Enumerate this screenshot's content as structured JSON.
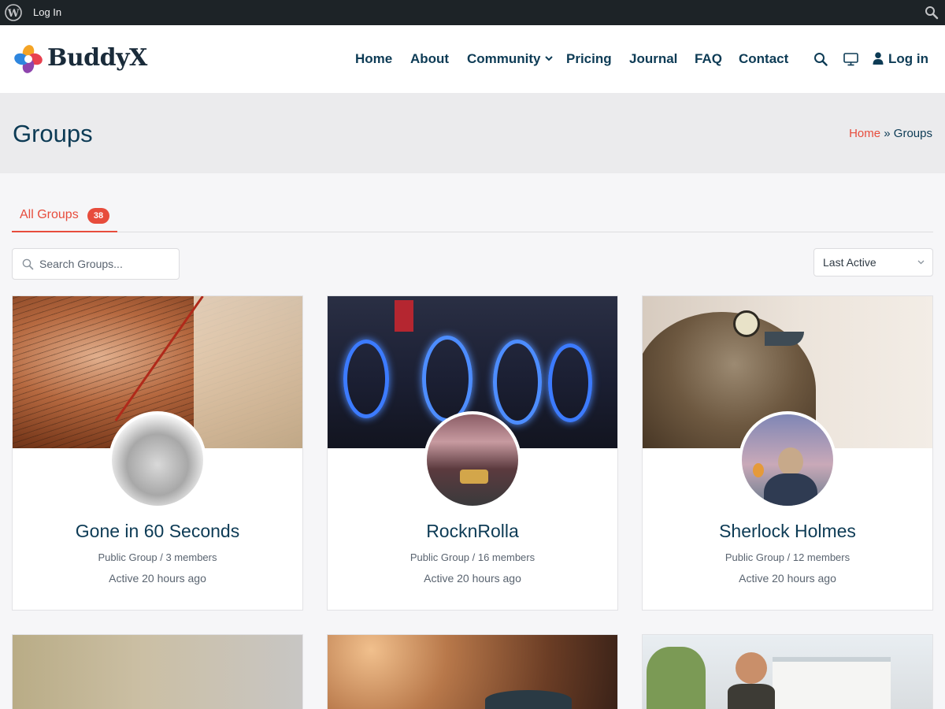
{
  "admin_bar": {
    "wp_icon": "wordpress-icon",
    "login_label": "Log In",
    "search_icon": "search-icon"
  },
  "header": {
    "logo_text": "BuddyX",
    "nav": [
      "Home",
      "About",
      "Community",
      "Pricing",
      "Journal",
      "FAQ",
      "Contact"
    ],
    "login_label": "Log in",
    "icons": [
      "search-icon",
      "monitor-icon",
      "user-icon",
      "chevron-down-icon"
    ]
  },
  "page": {
    "title": "Groups",
    "breadcrumb": {
      "home": "Home",
      "separator": "»",
      "current": "Groups"
    }
  },
  "tabs": {
    "all_label": "All Groups",
    "all_count": "38"
  },
  "search": {
    "placeholder": "Search Groups..."
  },
  "sort": {
    "selected": "Last Active"
  },
  "groups": [
    {
      "name": "Gone in 60 Seconds",
      "meta": "Public Group / 3 members",
      "active": "Active 20 hours ago"
    },
    {
      "name": "RocknRolla",
      "meta": "Public Group / 16 members",
      "active": "Active 20 hours ago"
    },
    {
      "name": "Sherlock Holmes",
      "meta": "Public Group / 12 members",
      "active": "Active 20 hours ago"
    }
  ],
  "colors": {
    "accent": "#e74c3c",
    "navy": "#0d3b55",
    "admin_bar": "#1d2327"
  }
}
